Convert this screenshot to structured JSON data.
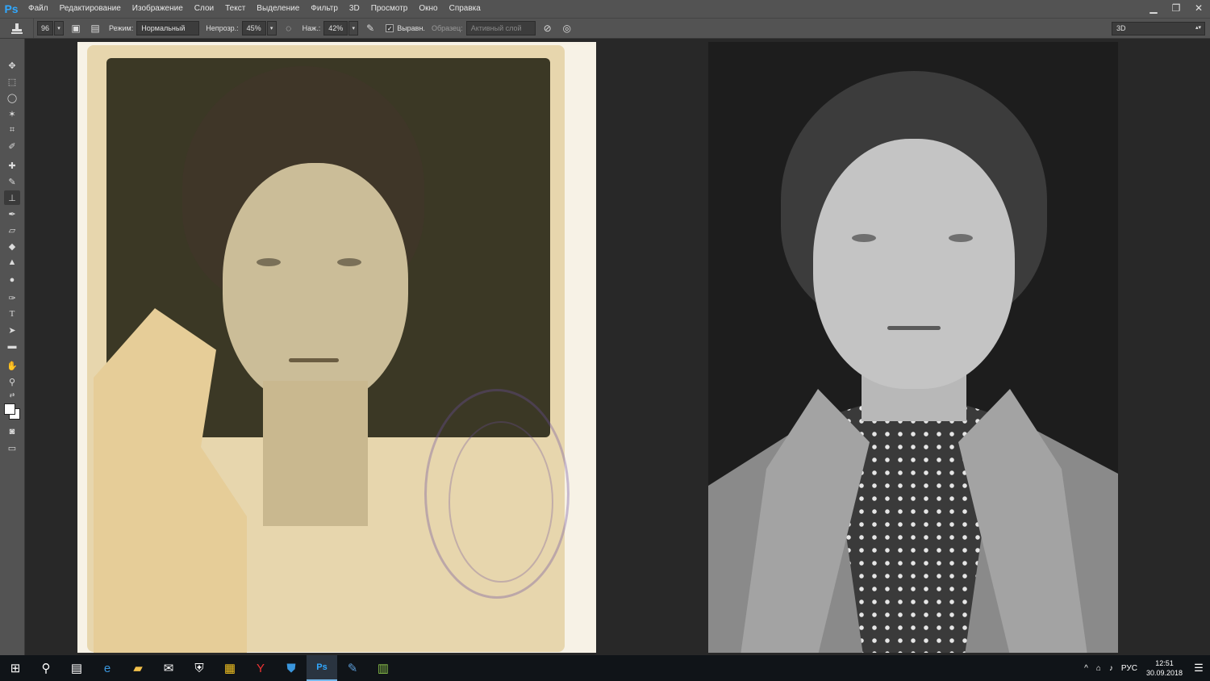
{
  "app": {
    "logo": "Ps"
  },
  "menu": [
    "Файл",
    "Редактирование",
    "Изображение",
    "Слои",
    "Текст",
    "Выделение",
    "Фильтр",
    "3D",
    "Просмотр",
    "Окно",
    "Справка"
  ],
  "window_controls": {
    "minimize": "▁",
    "restore": "❐",
    "close": "✕"
  },
  "options": {
    "brush_size": "96",
    "mode_label": "Режим:",
    "mode_value": "Нормальный",
    "opacity_label": "Непрозр.:",
    "opacity_value": "45%",
    "flow_label": "Наж.:",
    "flow_value": "42%",
    "aligned_label": "Выравн.",
    "sample_label": "Образец:",
    "sample_value": "Активный слой"
  },
  "workspace": "3D",
  "taskbar": {
    "apps": [
      "windows-start",
      "search",
      "task-view",
      "edge",
      "file-explorer",
      "mail",
      "security",
      "store",
      "yandex-browser",
      "defender",
      "photoshop",
      "editor",
      "spreadsheet"
    ],
    "language": "РУС",
    "time": "12:51",
    "date": "30.09.2018"
  }
}
